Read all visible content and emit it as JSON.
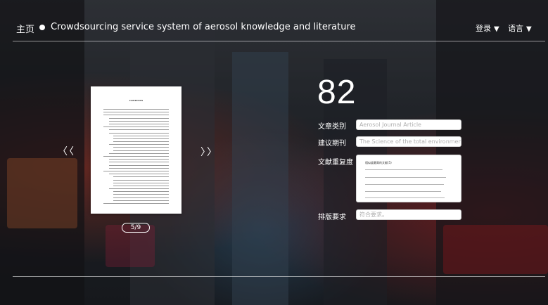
{
  "header": {
    "home_label": "主页",
    "site_title": "Crowdsourcing service system of aerosol knowledge and literature",
    "login_label": "登录",
    "language_label": "语言",
    "caret": "▼"
  },
  "preview": {
    "doc_heading": "CONTENTS",
    "prev_arrow": "〈〈",
    "next_arrow": "〉〉",
    "page_indicator": "5/9"
  },
  "form": {
    "score": "82",
    "category_label": "文章类别",
    "category_placeholder": "Aerosol Journal Article",
    "journal_label": "建议期刊",
    "journal_placeholder": "The Science of the total environment",
    "similarity_label": "文献重复度",
    "similarity_heading": "相似度最高的文献(5)",
    "layout_label": "排版要求",
    "layout_placeholder": "符合要求。"
  }
}
